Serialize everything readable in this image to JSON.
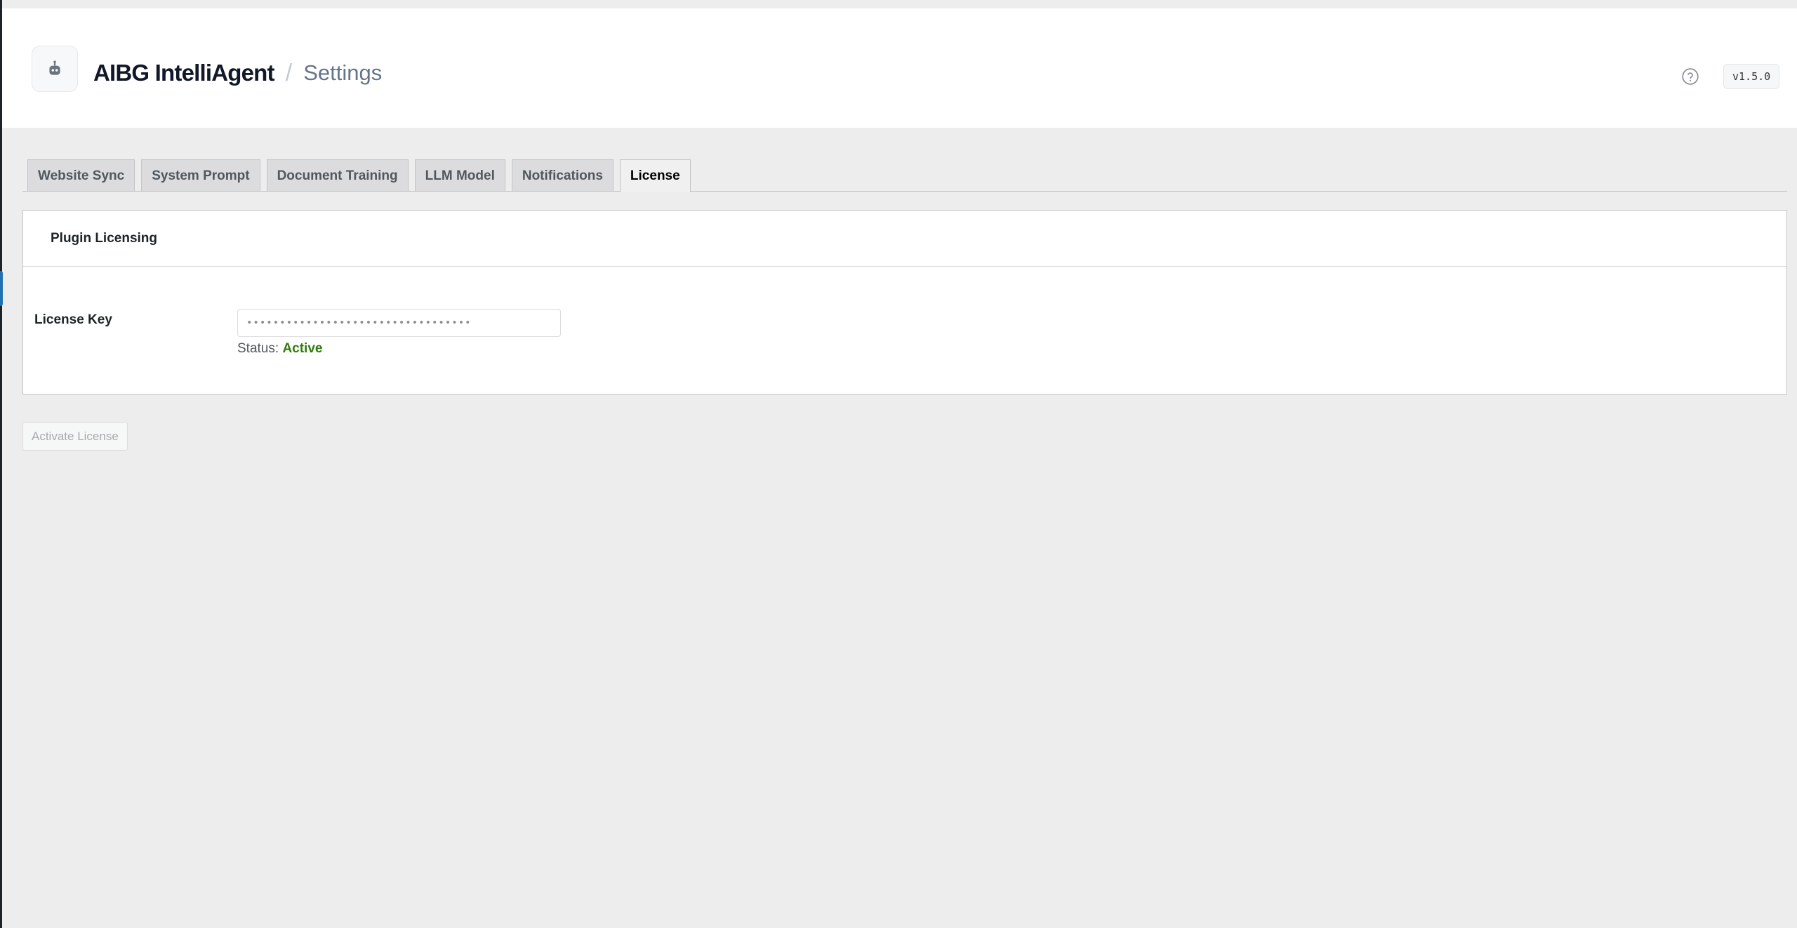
{
  "header": {
    "logo_icon": "robot-icon",
    "app_title": "AIBG IntelliAgent",
    "separator": "/",
    "page_title": "Settings",
    "help_icon": "help-circle-icon",
    "version": "v1.5.0"
  },
  "tabs": [
    {
      "label": "Website Sync",
      "active": false
    },
    {
      "label": "System Prompt",
      "active": false
    },
    {
      "label": "Document Training",
      "active": false
    },
    {
      "label": "LLM Model",
      "active": false
    },
    {
      "label": "Notifications",
      "active": false
    },
    {
      "label": "License",
      "active": true
    }
  ],
  "licensing": {
    "section_title": "Plugin Licensing",
    "field_label": "License Key",
    "license_value": "••••••••••••••••••••••••••••••••••",
    "status_label": "Status:",
    "status_value": "Active",
    "status_color": "#2e7d0a"
  },
  "actions": {
    "activate_label": "Activate License",
    "activate_disabled": true
  },
  "colors": {
    "accent": "#2271b1",
    "background": "#ededed"
  }
}
